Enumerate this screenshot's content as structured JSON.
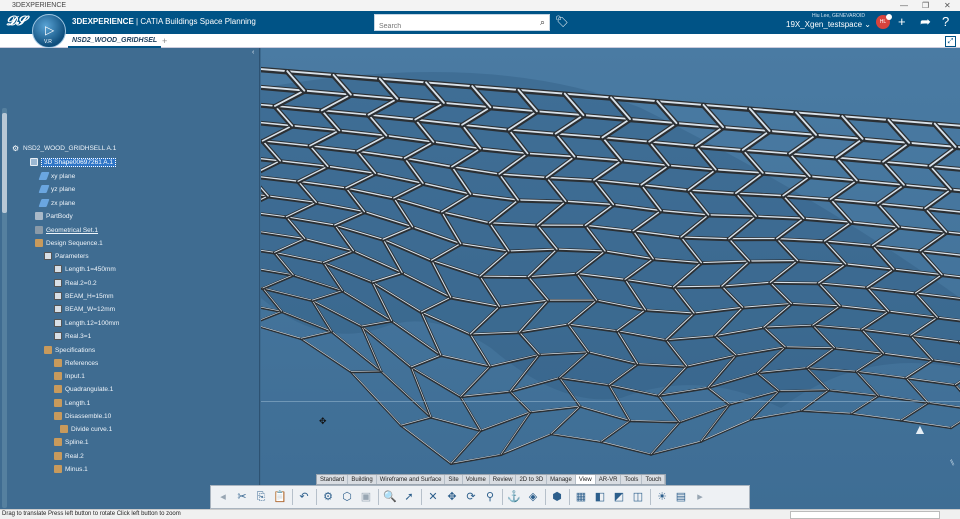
{
  "window": {
    "title": "3DEXPERIENCE"
  },
  "header": {
    "brand_prefix": "3DEXPERIENCE",
    "brand_product": "CATIA",
    "brand_app": "Buildings Space Planning",
    "compass_version": "V.R",
    "search_placeholder": "Search",
    "user_name": "Hiu Lee, GENEVAROID",
    "collab_space": "19X_Xgen_testspace",
    "avatar_initials": "HL"
  },
  "document_tab": {
    "label": "NSD2_WOOD_GRIDHSEL",
    "add_label": "+"
  },
  "tree": {
    "root": "NSD2_WOOD_GRIDHSELL A.1",
    "items": [
      {
        "label": "3D Shape00697261 A.1",
        "selected": true
      },
      {
        "label": "xy plane"
      },
      {
        "label": "yz plane"
      },
      {
        "label": "zx plane"
      },
      {
        "label": "PartBody"
      },
      {
        "label": "Geometrical Set.1"
      },
      {
        "label": "Design Sequence.1"
      },
      {
        "label": "Parameters"
      },
      {
        "label": "Length.1=450mm"
      },
      {
        "label": "Real.2=0.2"
      },
      {
        "label": "BEAM_H=15mm"
      },
      {
        "label": "BEAM_W=12mm"
      },
      {
        "label": "Length.12=100mm"
      },
      {
        "label": "Real.3=1"
      },
      {
        "label": "Specifications"
      },
      {
        "label": "References"
      },
      {
        "label": "Input.1"
      },
      {
        "label": "Quadrangulate.1"
      },
      {
        "label": "Length.1"
      },
      {
        "label": "Disassemble.10"
      },
      {
        "label": "Divide curve.1"
      },
      {
        "label": "Spline.1"
      },
      {
        "label": "Real.2"
      },
      {
        "label": "Minus.1"
      }
    ]
  },
  "section_tabs": [
    "Standard",
    "Building",
    "Wireframe and Surface",
    "Site",
    "Volume",
    "Review",
    "2D to 3D",
    "Manage",
    "View",
    "AR-VR",
    "Tools",
    "Touch"
  ],
  "active_section": "View",
  "status": {
    "text": "Drag to translate  Press left button to rotate  Click left button to zoom"
  }
}
